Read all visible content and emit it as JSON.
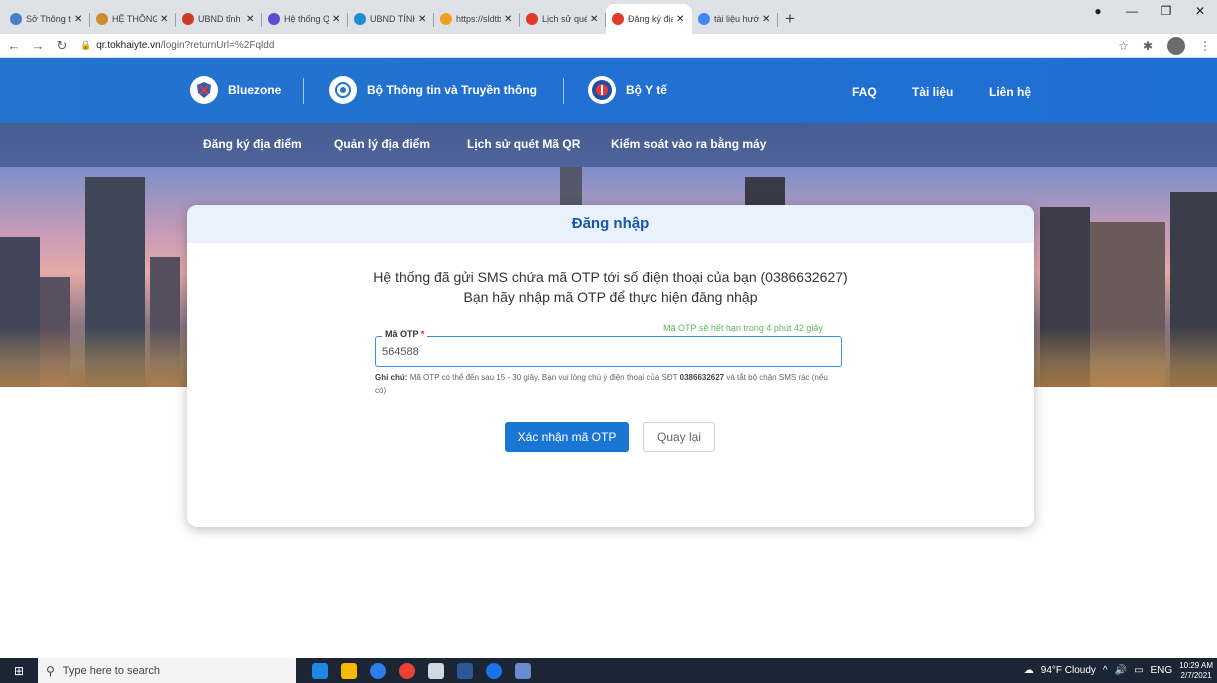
{
  "browser": {
    "tabs": [
      {
        "title": "Sở Thông tin và",
        "color": "#4a7fc1"
      },
      {
        "title": "HỆ THỐNG ĐĂ",
        "color": "#d08b2a"
      },
      {
        "title": "UBND tỉnh Tha",
        "color": "#d03a2a"
      },
      {
        "title": "Hệ thống Quản",
        "color": "#5b4bd1"
      },
      {
        "title": "UBND TỈNH TH",
        "color": "#1f8bd0"
      },
      {
        "title": "https://sldtbxh.",
        "color": "#f0a020"
      },
      {
        "title": "Lịch sử quét mã",
        "color": "#e03a2a"
      },
      {
        "title": "Đăng ký địa điể",
        "color": "#e03a2a"
      },
      {
        "title": "tài liệu hướng d",
        "color": "#4285f4"
      }
    ],
    "active_tab_index": 7,
    "new_tab": "+",
    "url_host": "qr.tokhaiyte.vn",
    "url_path": "/login?returnUrl=%2Fqldd"
  },
  "header": {
    "brand1": "Bluezone",
    "brand2": "Bộ Thông tin và Truyền thông",
    "brand3": "Bộ Y tế",
    "links": [
      "FAQ",
      "Tài liệu",
      "Liên hệ"
    ]
  },
  "nav": {
    "items": [
      "Đăng ký địa điểm",
      "Quản lý địa điểm",
      "Lịch sử quét Mã QR",
      "Kiểm soát vào ra bằng máy"
    ]
  },
  "login": {
    "title": "Đăng nhập",
    "message_line1": "Hệ thống đã gửi SMS chứa mã OTP tới số điện thoại của bạn (0386632627)",
    "message_line2": "Bạn hãy nhập mã OTP để thực hiện đăng nhập",
    "otp_label": "Mã OTP",
    "otp_required": "*",
    "otp_expire": "Mã OTP sẽ hết hạn trong 4 phút 42 giây",
    "otp_value": "564588",
    "note_prefix": "Ghi chú:",
    "note_text": "Mã OTP có thể đến sau 15 - 30 giây. Bạn vui lòng chú ý điện thoại của SĐT",
    "note_phone": "0386632627",
    "note_suffix": "và tắt bộ chặn SMS rác (nếu có)",
    "confirm_label": "Xác nhận mã OTP",
    "back_label": "Quay lại"
  },
  "taskbar": {
    "search_placeholder": "Type here to search",
    "weather": "94°F  Cloudy",
    "lang": "ENG",
    "time": "10:29 AM",
    "date": "2/7/2021"
  }
}
